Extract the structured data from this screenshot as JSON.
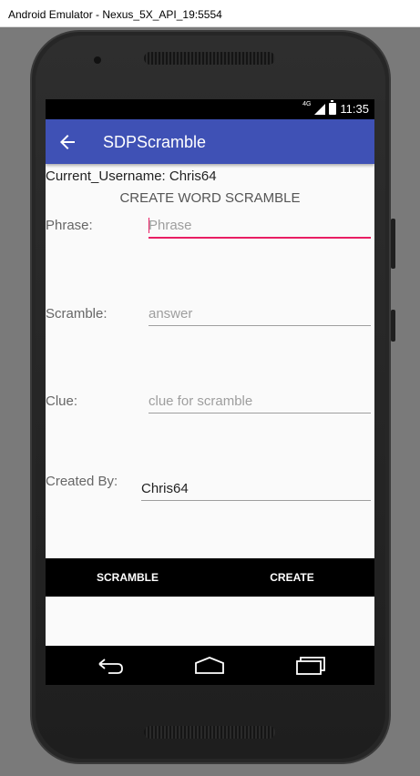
{
  "window": {
    "title": "Android Emulator - Nexus_5X_API_19:5554"
  },
  "status_bar": {
    "network": "4G",
    "time": "11:35"
  },
  "app_bar": {
    "title": "SDPScramble",
    "back_icon": "arrow-back-icon"
  },
  "current_username": "Current_Username: Chris64",
  "form": {
    "heading": "CREATE WORD SCRAMBLE",
    "phrase": {
      "label": "Phrase:",
      "placeholder": "Phrase",
      "value": ""
    },
    "scramble": {
      "label": "Scramble:",
      "placeholder": "answer",
      "value": ""
    },
    "clue": {
      "label": "Clue:",
      "placeholder": "clue for scramble",
      "value": ""
    },
    "created_by": {
      "label": "Created By:",
      "value": "Chris64"
    }
  },
  "buttons": {
    "scramble": "SCRAMBLE",
    "create": "CREATE"
  },
  "nav_bar": {
    "back": "nav-back-icon",
    "home": "nav-home-icon",
    "recents": "nav-recents-icon"
  },
  "colors": {
    "app_bar": "#3f51b5",
    "focus_accent": "#e91e63"
  }
}
